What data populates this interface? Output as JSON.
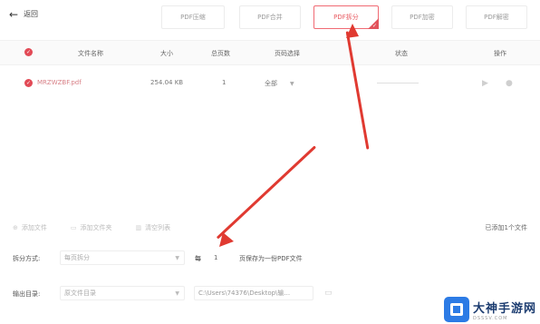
{
  "nav": {
    "back_label": "返回"
  },
  "tabs": [
    {
      "label": "PDF压缩"
    },
    {
      "label": "PDF合并"
    },
    {
      "label": "PDF拆分"
    },
    {
      "label": "PDF加密"
    },
    {
      "label": "PDF解密"
    }
  ],
  "table": {
    "headers": {
      "filename": "文件名称",
      "size": "大小",
      "total_pages": "总页数",
      "page_select": "页码选择",
      "status": "状态",
      "actions": "操作"
    },
    "rows": [
      {
        "filename": "MRZWZBF.pdf",
        "size": "254.04 KB",
        "pages": "1",
        "page_select": "全部"
      }
    ]
  },
  "toolbar": {
    "add_file": "添加文件",
    "add_folder": "添加文件夹",
    "clear_list": "清空列表"
  },
  "file_count": "已添加1个文件",
  "split": {
    "label": "拆分方式:",
    "mode": "每页拆分",
    "option_label": "每",
    "option_value": "1",
    "save_as": "页保存为一份PDF文件"
  },
  "output": {
    "label": "输出目录:",
    "mode": "原文件目录",
    "path": "C:\\Users\\74376\\Desktop\\输..."
  },
  "watermark": {
    "title": "大神手游网",
    "subtitle": "DSSSV.COM"
  },
  "colors": {
    "accent": "#e2535b",
    "annotation_arrow": "#e03a31"
  }
}
